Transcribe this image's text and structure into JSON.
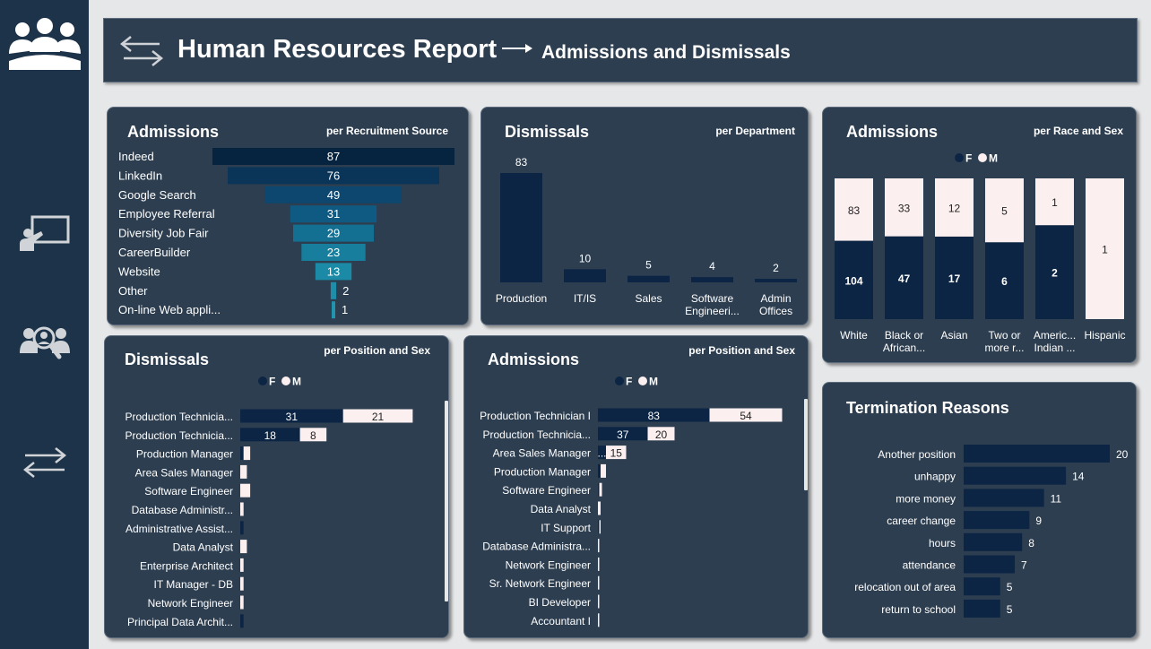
{
  "header": {
    "title": "Human Resources Report",
    "subtitle": "Admissions and Dismissals"
  },
  "sidebar": {
    "icons": [
      "team-icon",
      "presentation-icon",
      "people-search-icon",
      "swap-arrows-icon"
    ]
  },
  "colors": {
    "navy": "#0c2544",
    "pink": "#fcefef",
    "card": "#2d3e50",
    "sidebar": "#1d3349",
    "teal": [
      "#06243f",
      "#0a3458",
      "#0d466e",
      "#0f5a83",
      "#137093",
      "#177f9d",
      "#1a8aa6",
      "#1d8fab",
      "#1f95b0"
    ]
  },
  "cards": {
    "recruit": {
      "title": "Admissions",
      "sub": "per Recruitment Source"
    },
    "dept": {
      "title": "Dismissals",
      "sub": "per Department"
    },
    "race": {
      "title": "Admissions",
      "sub": "per Race and Sex"
    },
    "dis_pos": {
      "title": "Dismissals",
      "sub": "per Position and Sex"
    },
    "adm_pos": {
      "title": "Admissions",
      "sub": "per Position and Sex"
    },
    "term": {
      "title": "Termination Reasons"
    }
  },
  "chart_data": [
    {
      "id": "recruit",
      "type": "bar",
      "categories": [
        "Indeed",
        "LinkedIn",
        "Google Search",
        "Employee Referral",
        "Diversity Job Fair",
        "CareerBuilder",
        "Website",
        "Other",
        "On-line Web appli..."
      ],
      "values": [
        87,
        76,
        49,
        31,
        29,
        23,
        13,
        2,
        1
      ],
      "orientation": "horizontal-funnel"
    },
    {
      "id": "dept",
      "type": "bar",
      "categories": [
        "Production",
        "IT/IS",
        "Sales",
        "Software Engineeri...",
        "Admin Offices"
      ],
      "values": [
        83,
        10,
        5,
        4,
        2
      ]
    },
    {
      "id": "race",
      "type": "bar",
      "stacked": "100%",
      "legend": [
        "F",
        "M"
      ],
      "categories": [
        "White",
        "Black or African...",
        "Asian",
        "Two or more r...",
        "Americ... Indian ...",
        "Hispanic"
      ],
      "series": [
        {
          "name": "M",
          "values": [
            104,
            47,
            17,
            6,
            2,
            0
          ]
        },
        {
          "name": "F",
          "values": [
            83,
            33,
            12,
            5,
            1,
            1
          ]
        }
      ]
    },
    {
      "id": "dis_pos",
      "type": "bar",
      "stacked": true,
      "orientation": "horizontal",
      "legend": [
        "F",
        "M"
      ],
      "categories": [
        "Production Technicia...",
        "Production Technicia...",
        "Production Manager",
        "Area Sales Manager",
        "Software Engineer",
        "Database Administr...",
        "Administrative Assist...",
        "Data Analyst",
        "Enterprise Architect",
        "IT Manager - DB",
        "Network Engineer",
        "Principal Data Archit..."
      ],
      "series": [
        {
          "name": "F",
          "values": [
            31,
            18,
            1,
            0,
            0,
            0,
            1,
            0,
            0,
            0,
            0,
            1
          ]
        },
        {
          "name": "M",
          "values": [
            21,
            8,
            2,
            2,
            3,
            1,
            0,
            2,
            1,
            1,
            1,
            0
          ]
        }
      ],
      "value_labels": [
        [
          "31",
          "21"
        ],
        [
          "18",
          "8"
        ]
      ]
    },
    {
      "id": "adm_pos",
      "type": "bar",
      "stacked": true,
      "orientation": "horizontal",
      "legend": [
        "F",
        "M"
      ],
      "categories": [
        "Production Technician I",
        "Production Technicia...",
        "Area Sales Manager",
        "Production Manager",
        "Software Engineer",
        "Data Analyst",
        "IT Support",
        "Database Administra...",
        "Network Engineer",
        "Sr. Network Engineer",
        "BI Developer",
        "Accountant I"
      ],
      "series": [
        {
          "name": "F",
          "values": [
            83,
            37,
            6,
            2,
            1,
            0,
            1,
            0,
            0,
            0,
            0,
            0
          ]
        },
        {
          "name": "M",
          "values": [
            54,
            20,
            15,
            4,
            2,
            2,
            1,
            1,
            1,
            1,
            1,
            1
          ]
        }
      ],
      "value_labels": [
        [
          "83",
          "54"
        ],
        [
          "37",
          "20"
        ],
        [
          "...",
          "15"
        ]
      ]
    },
    {
      "id": "term",
      "type": "bar",
      "orientation": "horizontal",
      "categories": [
        "Another position",
        "unhappy",
        "more money",
        "career change",
        "hours",
        "attendance",
        "relocation out of area",
        "return to school"
      ],
      "values": [
        20,
        14,
        11,
        9,
        8,
        7,
        5,
        5
      ]
    }
  ]
}
